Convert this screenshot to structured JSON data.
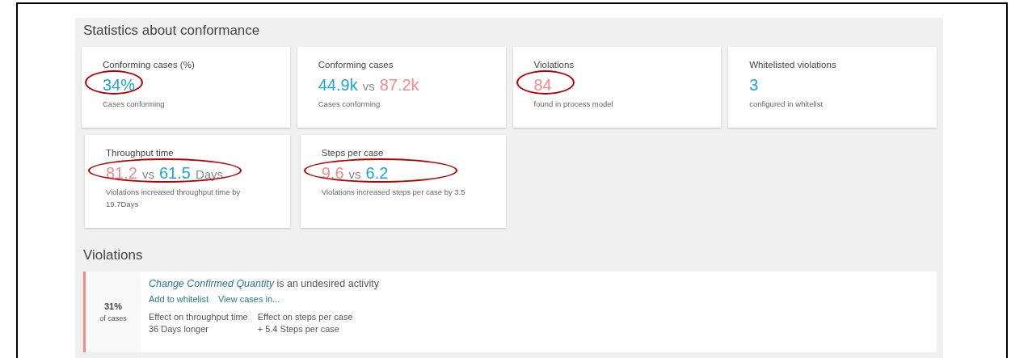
{
  "stats": {
    "title": "Statistics about conformance",
    "cards": [
      {
        "title": "Conforming cases (%)",
        "circled": true,
        "value": [
          {
            "text": "34%",
            "kind": "good"
          }
        ],
        "caption": "Cases conforming"
      },
      {
        "title": "Conforming cases",
        "circled": false,
        "value": [
          {
            "text": "44.9k",
            "kind": "good"
          },
          {
            "text": "vs",
            "kind": "neutral"
          },
          {
            "text": "87.2k",
            "kind": "bad"
          }
        ],
        "caption": "Cases conforming"
      },
      {
        "title": "Violations",
        "circled": true,
        "value": [
          {
            "text": "84",
            "kind": "bad"
          }
        ],
        "caption": "found in process model"
      },
      {
        "title": "Whitelisted violations",
        "circled": false,
        "value": [
          {
            "text": "3",
            "kind": "good"
          }
        ],
        "caption": "configured in whitelist"
      },
      {
        "title": "Throughput time",
        "circled": true,
        "value": [
          {
            "text": "81.2",
            "kind": "bad"
          },
          {
            "text": "vs",
            "kind": "neutral"
          },
          {
            "text": "61.5",
            "kind": "good"
          },
          {
            "text": "Days",
            "kind": "neutral"
          }
        ],
        "caption": "Violations increased throughput time by 19.7Days"
      },
      {
        "title": "Steps per case",
        "circled": true,
        "value": [
          {
            "text": "9.6",
            "kind": "bad"
          },
          {
            "text": "vs",
            "kind": "neutral"
          },
          {
            "text": "6.2",
            "kind": "good"
          }
        ],
        "caption": "Violations increased steps per case by 3.5"
      }
    ]
  },
  "violations": {
    "title": "Violations",
    "items": [
      {
        "share": "31%",
        "share_caption": "of cases",
        "activity": "Change Confirmed Quantity",
        "description": "is an undesired activity",
        "links": [
          "Add to whitelist",
          "View cases in..."
        ],
        "effects": [
          {
            "label": "Effect on throughput time",
            "value": "36 Days longer"
          },
          {
            "label": "Effect on steps per case",
            "value": "+ 5.4 Steps per case"
          }
        ]
      }
    ]
  }
}
